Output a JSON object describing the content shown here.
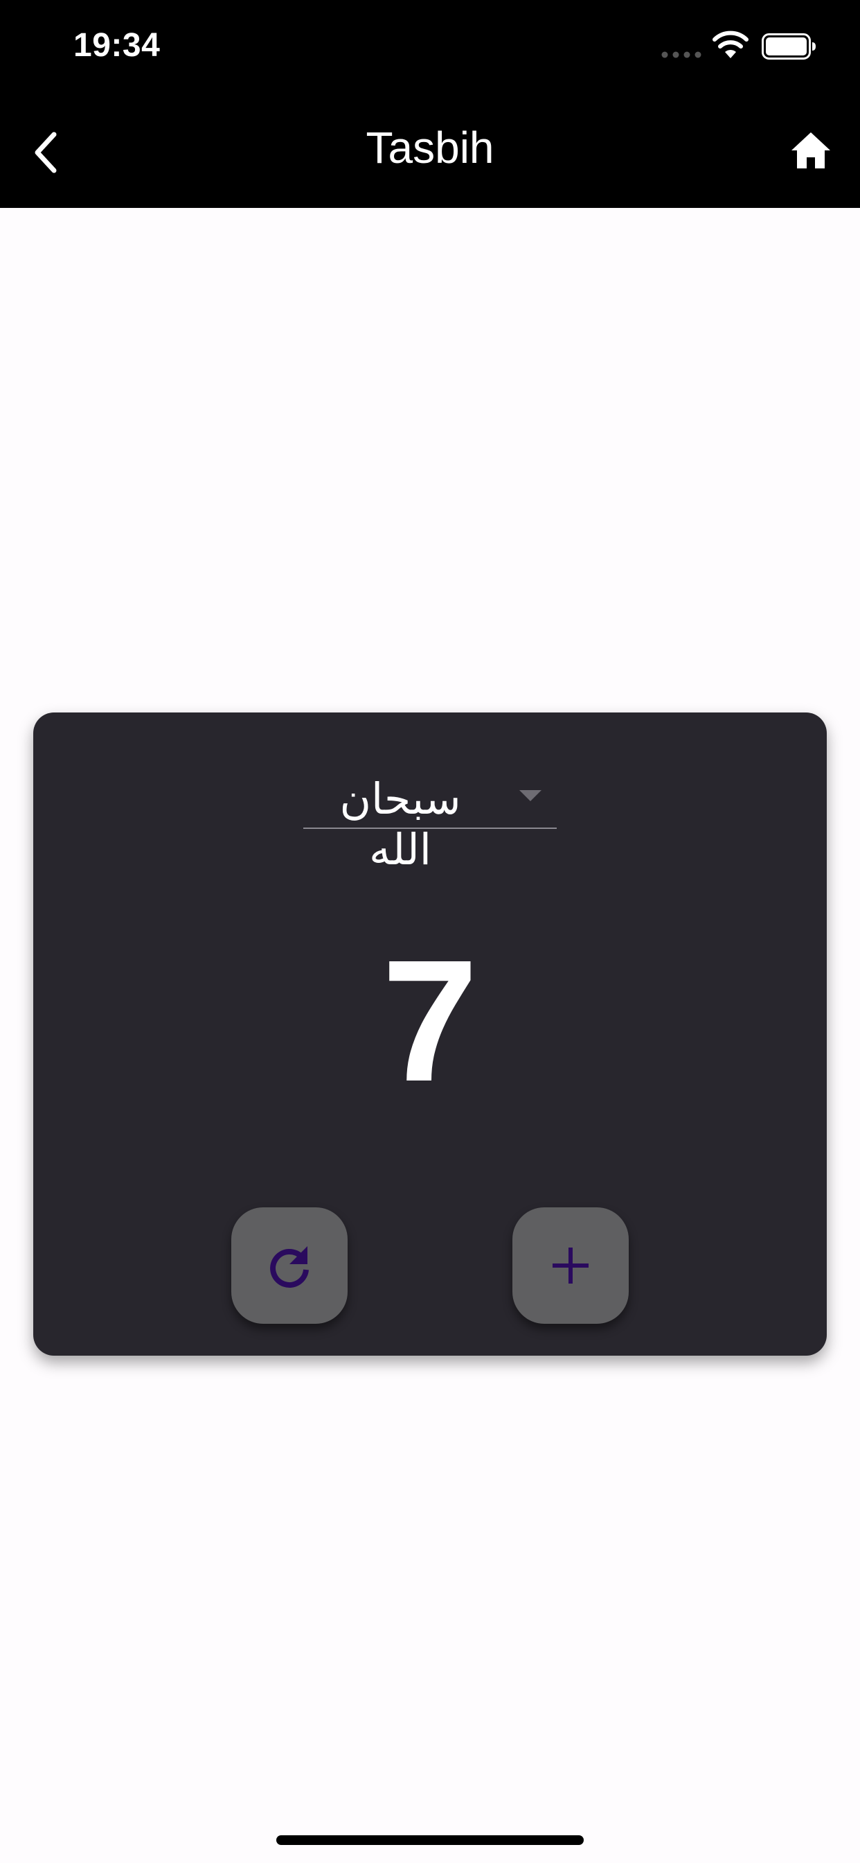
{
  "status_bar": {
    "time": "19:34",
    "icons": [
      "cellular-signal-icon",
      "wifi-icon",
      "battery-icon"
    ]
  },
  "nav": {
    "title": "Tasbih",
    "back_icon": "chevron-left-icon",
    "home_icon": "home-icon"
  },
  "counter_card": {
    "selected_dhikr": "سبحان الله",
    "count": "7",
    "reset_icon": "refresh-icon",
    "increment_icon": "plus-icon"
  },
  "colors": {
    "bar_background": "#000000",
    "page_background": "#fefcfe",
    "card_background": "#28262d",
    "button_background": "#5f5f61",
    "accent_icon": "#2a0a5e",
    "text_primary": "#ffffff"
  }
}
